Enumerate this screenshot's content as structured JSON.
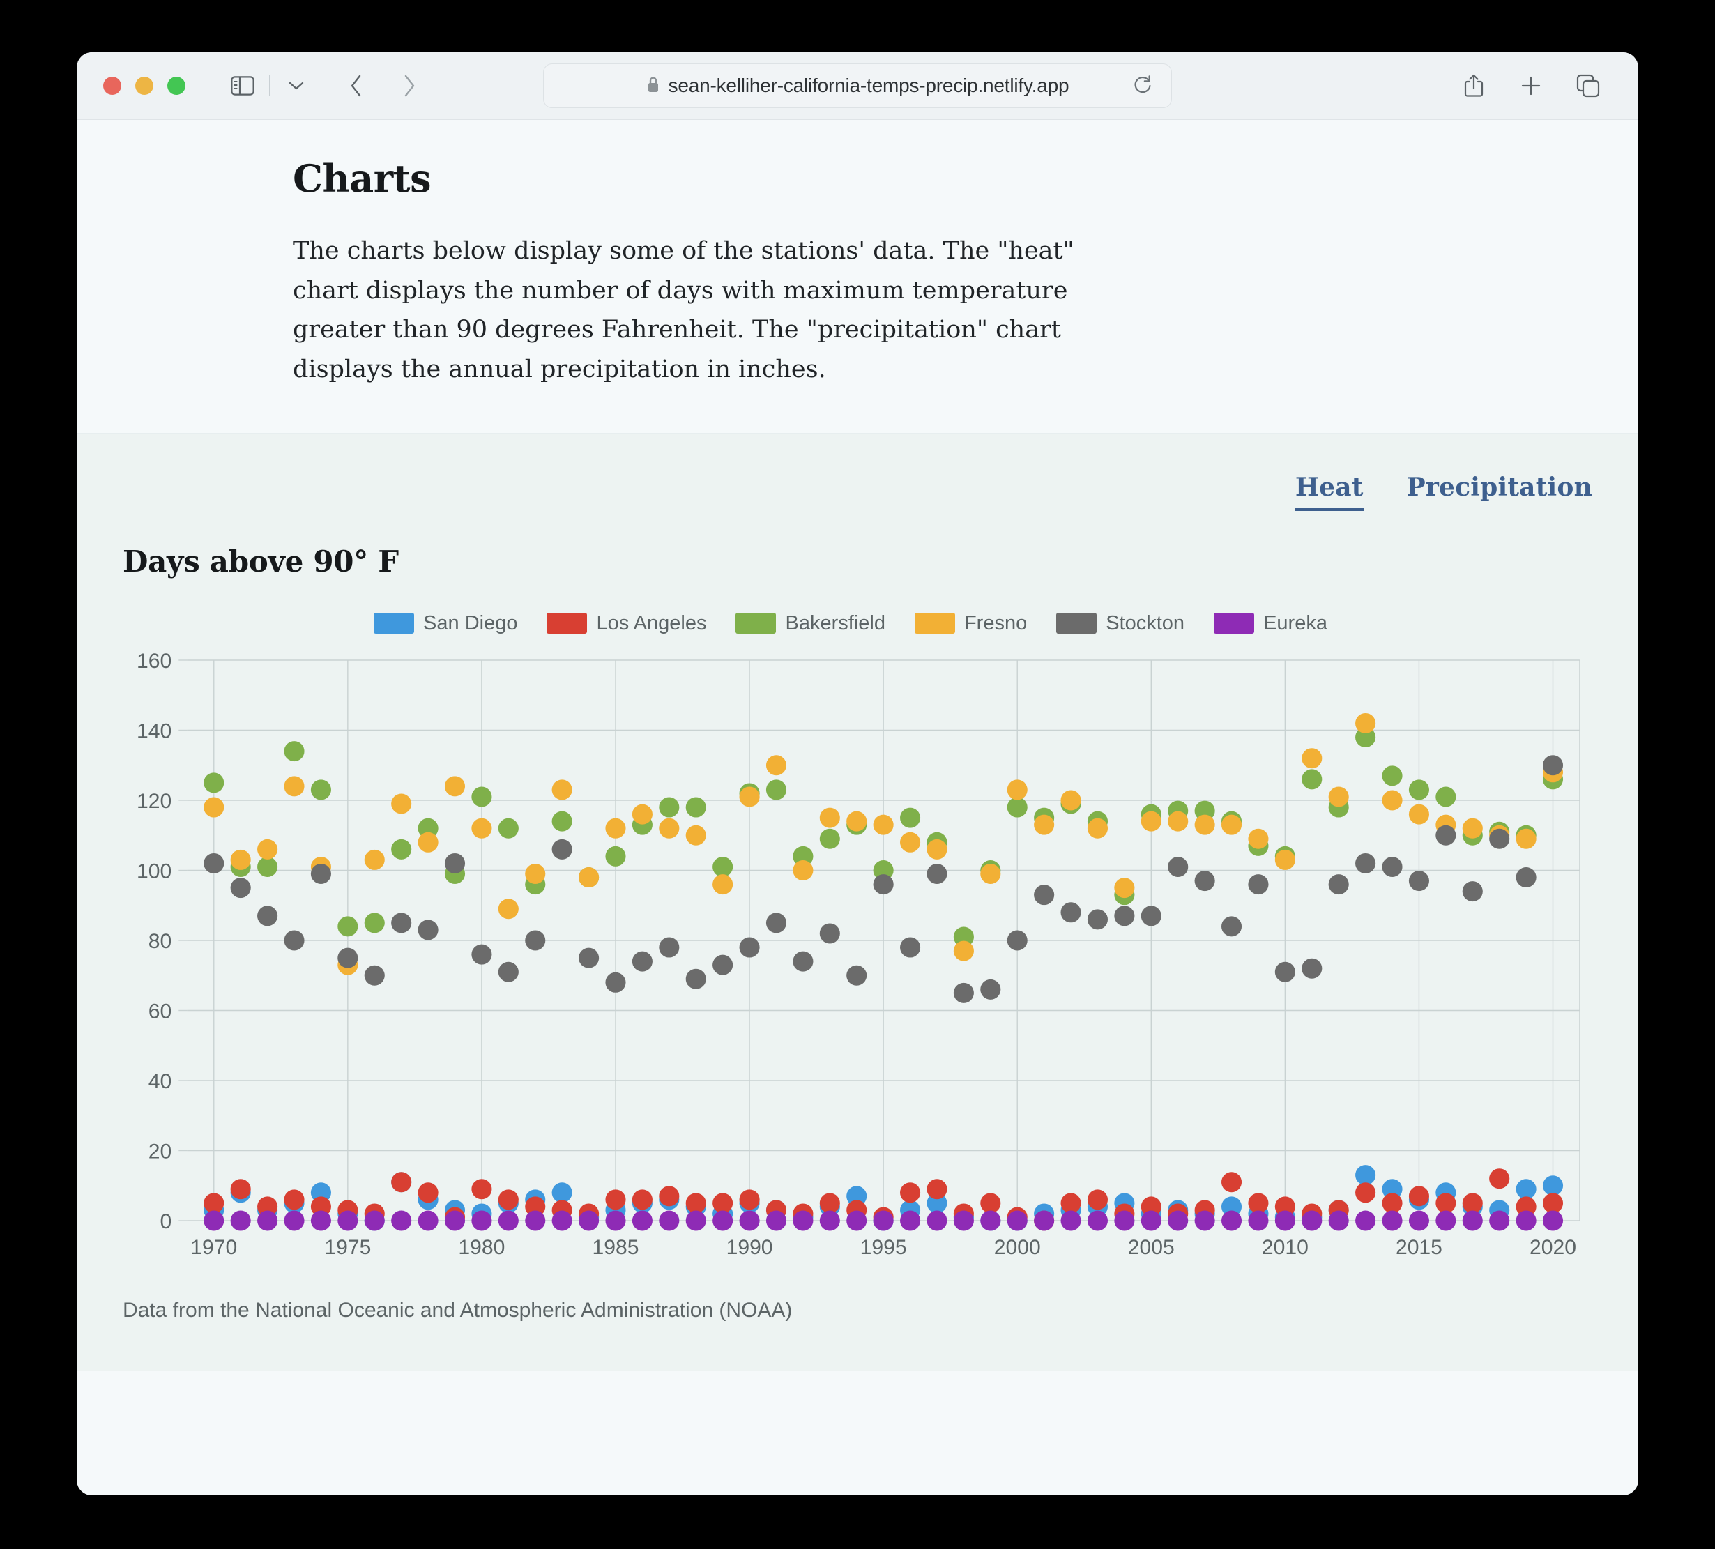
{
  "browser": {
    "url": "sean-kelliher-california-temps-precip.netlify.app",
    "lock_icon": "lock-icon",
    "reload_icon": "reload-icon",
    "back_icon": "chevron-left-icon",
    "forward_icon": "chevron-right-icon",
    "sidebar_icon": "sidebar-toggle-icon",
    "sidebar_chevron_icon": "chevron-down-icon",
    "share_icon": "share-icon",
    "newtab_icon": "plus-icon",
    "tabs_icon": "tab-overview-icon"
  },
  "intro": {
    "title": "Charts",
    "body": "The charts below display some of the stations' data. The \"heat\" chart displays the number of days with maximum temperature greater than 90 degrees Fahrenheit. The \"precipitation\" chart displays the annual precipitation in inches."
  },
  "tabs": [
    {
      "label": "Heat",
      "active": true
    },
    {
      "label": "Precipitation",
      "active": false
    }
  ],
  "credit": "Data from the National Oceanic and Atmospheric Administration (NOAA)",
  "colors": {
    "san_diego": "#3f98dd",
    "los_angeles": "#d83f32",
    "bakersfield": "#7fb04a",
    "fresno": "#f2b035",
    "stockton": "#6b6b6b",
    "eureka": "#8e2bb5",
    "tab_accent": "#3e5f8e",
    "page_bg": "#f5f9fa",
    "panel_bg": "#edf3f2",
    "grid": "#c9d2d2",
    "axis_text": "#5c6466"
  },
  "chart_data": {
    "type": "scatter",
    "title": "Days above 90° F",
    "xlabel": "",
    "ylabel": "",
    "xlim": [
      1969,
      2021
    ],
    "ylim": [
      0,
      160
    ],
    "yticks": [
      0,
      20,
      40,
      60,
      80,
      100,
      120,
      140,
      160
    ],
    "xticks": [
      1970,
      1975,
      1980,
      1985,
      1990,
      1995,
      2000,
      2005,
      2010,
      2015,
      2020
    ],
    "grid": true,
    "legend_position": "top-center",
    "series": [
      {
        "name": "Bakersfield",
        "color": "#7fb04a",
        "x": [
          1970,
          1971,
          1972,
          1973,
          1974,
          1975,
          1976,
          1977,
          1978,
          1979,
          1980,
          1981,
          1982,
          1983,
          1984,
          1985,
          1986,
          1987,
          1988,
          1989,
          1990,
          1991,
          1992,
          1993,
          1994,
          1995,
          1996,
          1997,
          1998,
          1999,
          2000,
          2001,
          2002,
          2003,
          2004,
          2005,
          2006,
          2007,
          2008,
          2009,
          2010,
          2011,
          2012,
          2013,
          2014,
          2015,
          2016,
          2017,
          2018,
          2019,
          2020
        ],
        "y": [
          125,
          101,
          101,
          134,
          123,
          84,
          85,
          106,
          112,
          99,
          121,
          112,
          96,
          114,
          98,
          104,
          113,
          118,
          118,
          101,
          122,
          123,
          104,
          109,
          113,
          100,
          115,
          108,
          81,
          100,
          118,
          115,
          119,
          114,
          93,
          116,
          117,
          117,
          114,
          107,
          104,
          126,
          118,
          138,
          127,
          123,
          121,
          110,
          111,
          110,
          126
        ]
      },
      {
        "name": "Fresno",
        "color": "#f2b035",
        "x": [
          1970,
          1971,
          1972,
          1973,
          1974,
          1975,
          1976,
          1977,
          1978,
          1979,
          1980,
          1981,
          1982,
          1983,
          1984,
          1985,
          1986,
          1987,
          1988,
          1989,
          1990,
          1991,
          1992,
          1993,
          1994,
          1995,
          1996,
          1997,
          1998,
          1999,
          2000,
          2001,
          2002,
          2003,
          2004,
          2005,
          2006,
          2007,
          2008,
          2009,
          2010,
          2011,
          2012,
          2013,
          2014,
          2015,
          2016,
          2017,
          2018,
          2019,
          2020
        ],
        "y": [
          118,
          103,
          106,
          124,
          101,
          73,
          103,
          119,
          108,
          124,
          112,
          89,
          99,
          123,
          98,
          112,
          116,
          112,
          110,
          96,
          121,
          130,
          100,
          115,
          114,
          113,
          108,
          106,
          77,
          99,
          123,
          113,
          120,
          112,
          95,
          114,
          114,
          113,
          113,
          109,
          103,
          132,
          121,
          142,
          120,
          116,
          113,
          112,
          110,
          109,
          128
        ]
      },
      {
        "name": "Stockton",
        "color": "#6b6b6b",
        "x": [
          1970,
          1971,
          1972,
          1973,
          1974,
          1975,
          1976,
          1977,
          1978,
          1979,
          1980,
          1981,
          1982,
          1983,
          1984,
          1985,
          1986,
          1987,
          1988,
          1989,
          1990,
          1991,
          1992,
          1993,
          1994,
          1995,
          1996,
          1997,
          1998,
          1999,
          2000,
          2001,
          2002,
          2003,
          2004,
          2005,
          2006,
          2007,
          2008,
          2009,
          2010,
          2011,
          2012,
          2013,
          2014,
          2015,
          2016,
          2017,
          2018,
          2019,
          2020
        ],
        "y": [
          102,
          95,
          87,
          80,
          99,
          75,
          70,
          85,
          83,
          102,
          76,
          71,
          80,
          106,
          75,
          68,
          74,
          78,
          69,
          73,
          78,
          85,
          74,
          82,
          70,
          96,
          78,
          99,
          65,
          66,
          80,
          93,
          88,
          86,
          87,
          87,
          101,
          97,
          84,
          96,
          71,
          72,
          96,
          102,
          101,
          97,
          110,
          94,
          109,
          98,
          130
        ]
      },
      {
        "name": "San Diego",
        "color": "#3f98dd",
        "x": [
          1970,
          1971,
          1972,
          1973,
          1974,
          1975,
          1976,
          1977,
          1978,
          1979,
          1980,
          1981,
          1982,
          1983,
          1984,
          1985,
          1986,
          1987,
          1988,
          1989,
          1990,
          1991,
          1992,
          1993,
          1994,
          1995,
          1996,
          1997,
          1998,
          1999,
          2000,
          2001,
          2002,
          2003,
          2004,
          2005,
          2006,
          2007,
          2008,
          2009,
          2010,
          2011,
          2012,
          2013,
          2014,
          2015,
          2016,
          2017,
          2018,
          2019,
          2020
        ],
        "y": [
          3,
          8,
          3,
          5,
          8,
          2,
          0,
          11,
          6,
          3,
          2,
          5,
          6,
          8,
          1,
          3,
          5,
          6,
          4,
          2,
          5,
          3,
          1,
          4,
          7,
          0,
          3,
          5,
          1,
          0,
          0,
          2,
          3,
          4,
          5,
          2,
          3,
          2,
          4,
          2,
          1,
          1,
          3,
          13,
          9,
          6,
          8,
          4,
          3,
          9,
          10
        ]
      },
      {
        "name": "Los Angeles",
        "color": "#d83f32",
        "x": [
          1970,
          1971,
          1972,
          1973,
          1974,
          1975,
          1976,
          1977,
          1978,
          1979,
          1980,
          1981,
          1982,
          1983,
          1984,
          1985,
          1986,
          1987,
          1988,
          1989,
          1990,
          1991,
          1992,
          1993,
          1994,
          1995,
          1996,
          1997,
          1998,
          1999,
          2000,
          2001,
          2002,
          2003,
          2004,
          2005,
          2006,
          2007,
          2008,
          2009,
          2010,
          2011,
          2012,
          2013,
          2014,
          2015,
          2016,
          2017,
          2018,
          2019,
          2020
        ],
        "y": [
          5,
          9,
          4,
          6,
          4,
          3,
          2,
          11,
          8,
          1,
          9,
          6,
          4,
          3,
          2,
          6,
          6,
          7,
          5,
          5,
          6,
          3,
          2,
          5,
          3,
          1,
          8,
          9,
          2,
          5,
          1,
          0,
          5,
          6,
          2,
          4,
          2,
          3,
          11,
          5,
          4,
          2,
          3,
          8,
          5,
          7,
          5,
          5,
          12,
          4,
          5
        ]
      },
      {
        "name": "Eureka",
        "color": "#8e2bb5",
        "x": [
          1970,
          1971,
          1972,
          1973,
          1974,
          1975,
          1976,
          1977,
          1978,
          1979,
          1980,
          1981,
          1982,
          1983,
          1984,
          1985,
          1986,
          1987,
          1988,
          1989,
          1990,
          1991,
          1992,
          1993,
          1994,
          1995,
          1996,
          1997,
          1998,
          1999,
          2000,
          2001,
          2002,
          2003,
          2004,
          2005,
          2006,
          2007,
          2008,
          2009,
          2010,
          2011,
          2012,
          2013,
          2014,
          2015,
          2016,
          2017,
          2018,
          2019,
          2020
        ],
        "y": [
          0,
          0,
          0,
          0,
          0,
          0,
          0,
          0,
          0,
          0,
          0,
          0,
          0,
          0,
          0,
          0,
          0,
          0,
          0,
          0,
          0,
          0,
          0,
          0,
          0,
          0,
          0,
          0,
          0,
          0,
          0,
          0,
          0,
          0,
          0,
          0,
          0,
          0,
          0,
          0,
          0,
          0,
          0,
          0,
          0,
          0,
          0,
          0,
          0,
          0,
          0
        ]
      }
    ]
  }
}
